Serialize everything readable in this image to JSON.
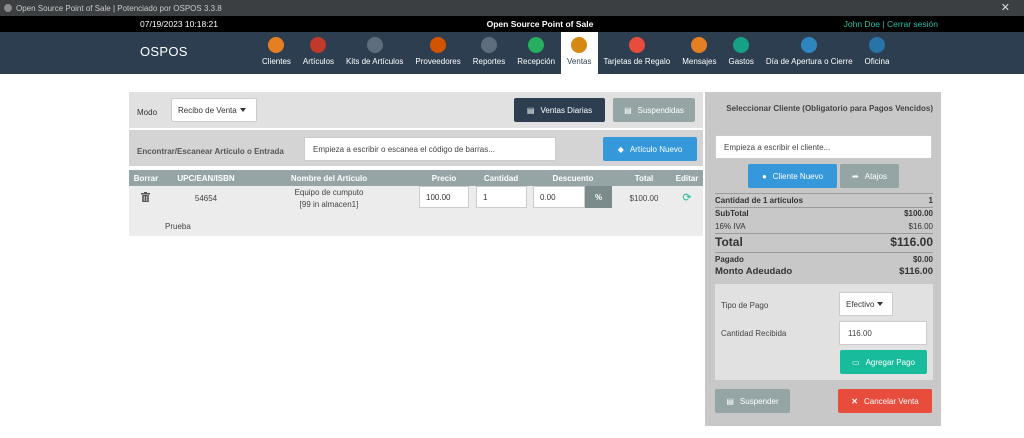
{
  "window": {
    "title": "Open Source Point of Sale | Potenciado por OSPOS 3.3.8",
    "close": "✕"
  },
  "topbar": {
    "datetime": "07/19/2023 10:18:21",
    "title": "Open Source Point of Sale",
    "user": "John Doe",
    "separator": " | ",
    "logout": "Cerrar sesión"
  },
  "brand": "OSPOS",
  "nav": [
    {
      "label": "Clientes",
      "icon": "customers-icon",
      "color": "#e67e22"
    },
    {
      "label": "Artículos",
      "icon": "items-icon",
      "color": "#c0392b"
    },
    {
      "label": "Kits de Artículos",
      "icon": "item-kits-icon",
      "color": "#5d6d7e"
    },
    {
      "label": "Proveedores",
      "icon": "suppliers-icon",
      "color": "#d35400"
    },
    {
      "label": "Reportes",
      "icon": "reports-icon",
      "color": "#5d6d7e"
    },
    {
      "label": "Recepción",
      "icon": "receivings-icon",
      "color": "#27ae60"
    },
    {
      "label": "Ventas",
      "icon": "sales-icon",
      "color": "#d68910",
      "active": true
    },
    {
      "label": "Tarjetas de Regalo",
      "icon": "giftcards-icon",
      "color": "#e74c3c"
    },
    {
      "label": "Mensajes",
      "icon": "messages-icon",
      "color": "#e67e22"
    },
    {
      "label": "Gastos",
      "icon": "expenses-icon",
      "color": "#16a085"
    },
    {
      "label": "Día de Apertura o Cierre",
      "icon": "cashups-icon",
      "color": "#2e86c1"
    },
    {
      "label": "Oficina",
      "icon": "office-icon",
      "color": "#2874a6"
    }
  ],
  "sale": {
    "mode_label": "Modo",
    "mode_value": "Recibo de Venta",
    "daily_sales": "Ventas Diarias",
    "suspended": "Suspendidas",
    "find_label": "Encontrar/Escanear Artículo o Entrada",
    "find_placeholder": "Empieza a escribir o escanea el código de barras...",
    "new_item": "Artículo Nuevo",
    "columns": [
      "Borrar",
      "UPC/EAN/ISBN",
      "Nombre del Artículo",
      "Precio",
      "Cantidad",
      "Descuento",
      "Total",
      "Editar"
    ],
    "row": {
      "upc": "54654",
      "name": "Equipo de cumputo",
      "stock": "[99 in almacen1]",
      "price": "100.00",
      "quantity": "1",
      "discount": "0.00",
      "discount_type": "%",
      "total": "$100.00",
      "description": "Prueba"
    }
  },
  "customer": {
    "select_label": "Seleccionar Cliente (Obligatorio para Pagos Vencidos)",
    "placeholder": "Empieza a escribir el cliente...",
    "new_customer": "Cliente Nuevo",
    "shortcuts": "Atajos"
  },
  "summary": {
    "items_label": "Cantidad de 1 artículos",
    "items_value": "1",
    "subtotal_label": "SubTotal",
    "subtotal_value": "$100.00",
    "tax_label": "16% IVA",
    "tax_value": "$16.00",
    "total_label": "Total",
    "total_value": "$116.00",
    "paid_label": "Pagado",
    "paid_value": "$0.00",
    "due_label": "Monto Adeudado",
    "due_value": "$116.00"
  },
  "payment": {
    "type_label": "Tipo de Pago",
    "type_value": "Efectivo",
    "amount_label": "Cantidad Recibida",
    "amount_value": "116.00",
    "add_payment": "Agregar Pago",
    "suspend": "Suspender",
    "cancel": "Cancelar Venta"
  }
}
